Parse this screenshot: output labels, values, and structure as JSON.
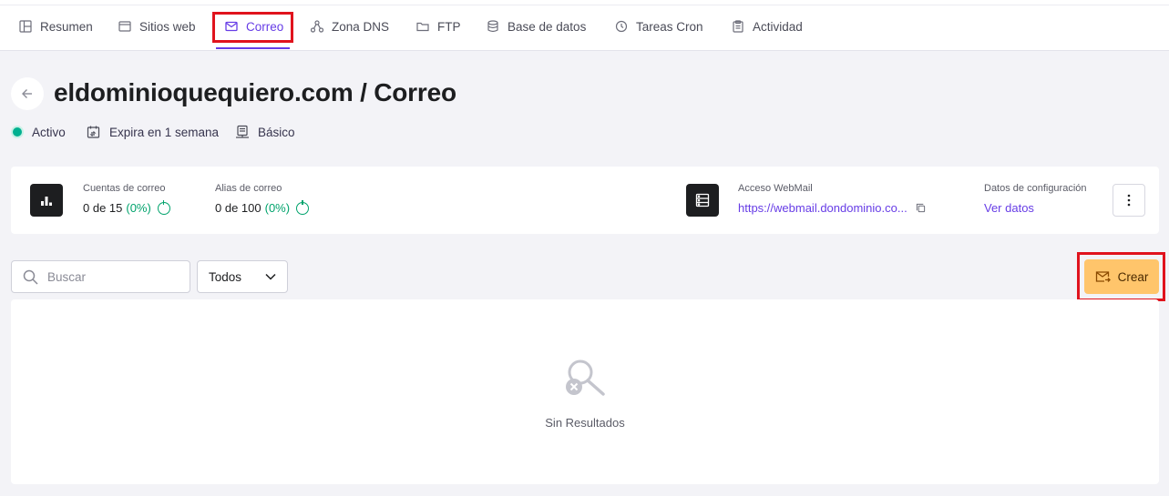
{
  "tabs": [
    {
      "label": "Resumen",
      "icon": "layout-icon"
    },
    {
      "label": "Sitios web",
      "icon": "browser-icon"
    },
    {
      "label": "Correo",
      "icon": "mail-icon",
      "active": true
    },
    {
      "label": "Zona DNS",
      "icon": "network-icon"
    },
    {
      "label": "FTP",
      "icon": "folder-icon"
    },
    {
      "label": "Base de datos",
      "icon": "database-icon"
    },
    {
      "label": "Tareas Cron",
      "icon": "clock-icon"
    },
    {
      "label": "Actividad",
      "icon": "clipboard-icon"
    }
  ],
  "page": {
    "title": "eldominioquequiero.com / Correo"
  },
  "status": {
    "state": "Activo",
    "expiry": "Expira en 1 semana",
    "plan": "Básico"
  },
  "stats": {
    "email_accounts": {
      "label": "Cuentas de correo",
      "value": "0 de 15",
      "percent": "(0%)"
    },
    "email_aliases": {
      "label": "Alias de correo",
      "value": "0 de 100",
      "percent": "(0%)"
    },
    "webmail": {
      "label": "Acceso WebMail",
      "url": "https://webmail.dondominio.co..."
    },
    "config": {
      "label": "Datos de configuración",
      "link": "Ver datos"
    }
  },
  "toolbar": {
    "search_placeholder": "Buscar",
    "filter_value": "Todos",
    "create_label": "Crear"
  },
  "results": {
    "empty_text": "Sin Resultados"
  },
  "colors": {
    "accent": "#673de6",
    "create_button": "#ffc56b",
    "success": "#00a36c",
    "highlight": "#e0131d"
  }
}
